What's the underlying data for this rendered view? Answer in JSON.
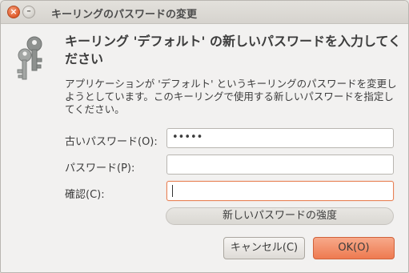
{
  "window": {
    "title": "キーリングのパスワードの変更",
    "close_symbol": "×",
    "minimize_symbol": "–"
  },
  "dialog": {
    "heading": "キーリング 'デフォルト' の新しいパスワードを入力してください",
    "description": "アプリケーションが 'デフォルト' というキーリングのパスワードを変更しようとしています。このキーリングで使用する新しいパスワードを指定してください。"
  },
  "form": {
    "old_password_label": "古いパスワード(O):",
    "old_password_value": "•••••",
    "password_label": "パスワード(P):",
    "password_value": "",
    "confirm_label": "確認(C):",
    "confirm_value": ""
  },
  "strength_label": "新しいパスワードの強度",
  "buttons": {
    "cancel": "キャンセル(C)",
    "ok": "OK(O)"
  }
}
